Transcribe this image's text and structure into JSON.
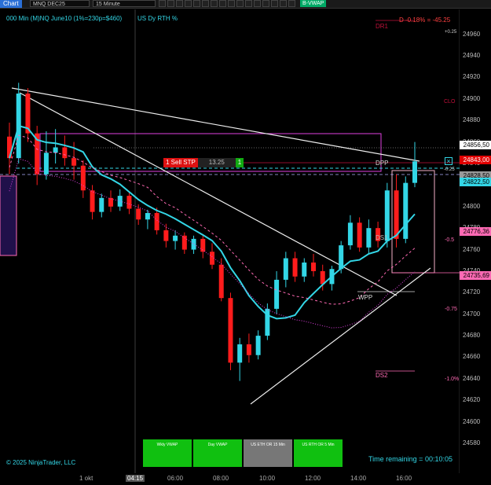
{
  "toolbar": {
    "chart_label": "Chart",
    "instrument": "MNQ DEC25",
    "interval": "15 Minute",
    "indicator_label": "B-VWAP"
  },
  "header": {
    "title": "000 Min (M)NQ June10 (1%=230p=$460)",
    "session": "US Dy RTH %"
  },
  "colors": {
    "cyan": "#33d6e6",
    "up_candle": "#33d6e6",
    "down_candle": "#ff1c1c",
    "magenta": "#e040e0",
    "pink": "#ff6ab4",
    "white": "#ffffff",
    "red_level": "#c0103a"
  },
  "levels": {
    "dr1": "DR1",
    "dpp": "DPP",
    "ds1": "DS1",
    "wpp": "WPP",
    "ds2": "DS2",
    "pl_label": "D -0.18% = -45.25",
    "clo": "CLO",
    "pct_plus_025": "+0.25",
    "pct_025": "-0.25",
    "pct_05": "-0.5",
    "pct_075": "-0.75",
    "pct_10": "-1.0%"
  },
  "order": {
    "qty_label": "1 Sell STP",
    "price_label": "13.25",
    "count": "1",
    "close_icon": "×"
  },
  "vwap_buttons": [
    {
      "label": "Wkly VWAP",
      "color": "#10c010"
    },
    {
      "label": "Day VWAP",
      "color": "#10c010"
    },
    {
      "label": "US ETH OR 15 Min",
      "color": "#777777"
    },
    {
      "label": "US RTH OR 5 Min",
      "color": "#10c010"
    }
  ],
  "footer": {
    "copyright": "© 2025 NinjaTrader, LLC",
    "time_remaining": "Time remaining = 00:10:05"
  },
  "price_tags": [
    {
      "label": "24856,50",
      "bg": "#ffffff",
      "fg": "#000000"
    },
    {
      "label": "24843,00",
      "bg": "#e00000",
      "fg": "#ffffff"
    },
    {
      "label": "24828,50",
      "bg": "#9a9a9a",
      "fg": "#000000"
    },
    {
      "label": "24822,50",
      "bg": "#33d6e6",
      "fg": "#000000"
    },
    {
      "label": "24776,36",
      "bg": "#ff6ab4",
      "fg": "#000000"
    },
    {
      "label": "24735,69",
      "bg": "#ff6ab4",
      "fg": "#000000"
    }
  ],
  "chart_data": {
    "type": "candlestick",
    "x_ticks": [
      "1 okt",
      "04:15",
      "06:00",
      "08:00",
      "10:00",
      "12:00",
      "14:00",
      "16:00"
    ],
    "y_ticks": [
      24960,
      24940,
      24920,
      24900,
      24880,
      24860,
      24840,
      24820,
      24800,
      24780,
      24760,
      24740,
      24720,
      24700,
      24680,
      24660,
      24640,
      24620,
      24600,
      24580
    ],
    "ylim": [
      24572,
      24970
    ],
    "candles": [
      [
        24865,
        24878,
        24830,
        24845
      ],
      [
        24845,
        24915,
        24840,
        24905
      ],
      [
        24905,
        24910,
        24860,
        24868
      ],
      [
        24868,
        24875,
        24820,
        24830
      ],
      [
        24830,
        24870,
        24825,
        24850
      ],
      [
        24850,
        24872,
        24840,
        24855
      ],
      [
        24855,
        24866,
        24838,
        24845
      ],
      [
        24845,
        24860,
        24825,
        24838
      ],
      [
        24838,
        24843,
        24808,
        24815
      ],
      [
        24815,
        24820,
        24788,
        24795
      ],
      [
        24795,
        24812,
        24790,
        24808
      ],
      [
        24808,
        24815,
        24795,
        24800
      ],
      [
        24800,
        24816,
        24796,
        24810
      ],
      [
        24810,
        24814,
        24793,
        24798
      ],
      [
        24798,
        24802,
        24783,
        24788
      ],
      [
        24788,
        24797,
        24779,
        24794
      ],
      [
        24794,
        24799,
        24774,
        24778
      ],
      [
        24778,
        24784,
        24762,
        24768
      ],
      [
        24768,
        24778,
        24760,
        24773
      ],
      [
        24773,
        24776,
        24756,
        24760
      ],
      [
        24760,
        24773,
        24756,
        24770
      ],
      [
        24770,
        24773,
        24752,
        24758
      ],
      [
        24758,
        24766,
        24742,
        24746
      ],
      [
        24746,
        24752,
        24712,
        24715
      ],
      [
        24715,
        24720,
        24648,
        24655
      ],
      [
        24655,
        24678,
        24638,
        24672
      ],
      [
        24672,
        24682,
        24655,
        24662
      ],
      [
        24662,
        24685,
        24658,
        24680
      ],
      [
        24680,
        24710,
        24676,
        24705
      ],
      [
        24705,
        24740,
        24700,
        24732
      ],
      [
        24732,
        24758,
        24725,
        24752
      ],
      [
        24752,
        24758,
        24730,
        24735
      ],
      [
        24735,
        24752,
        24730,
        24748
      ],
      [
        24748,
        24756,
        24735,
        24740
      ],
      [
        24740,
        24746,
        24722,
        24728
      ],
      [
        24728,
        24745,
        24722,
        24742
      ],
      [
        24742,
        24768,
        24738,
        24764
      ],
      [
        24764,
        24792,
        24760,
        24785
      ],
      [
        24785,
        24790,
        24758,
        24762
      ],
      [
        24762,
        24788,
        24756,
        24780
      ],
      [
        24780,
        24786,
        24762,
        24768
      ],
      [
        24768,
        24822,
        24762,
        24815
      ],
      [
        24815,
        24830,
        24762,
        24770
      ],
      [
        24770,
        24828,
        24766,
        24822
      ],
      [
        24822,
        24860,
        24818,
        24842
      ]
    ]
  }
}
